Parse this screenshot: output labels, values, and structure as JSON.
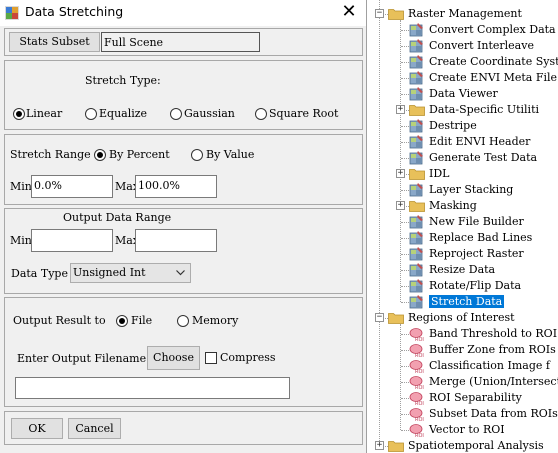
{
  "dialog": {
    "title": "Data Stretching",
    "stats_subset_button": "Stats Subset",
    "subset_value": "Full Scene",
    "stretch_type": {
      "label": "Stretch Type:",
      "options": [
        "Linear",
        "Equalize",
        "Gaussian",
        "Square Root"
      ],
      "selected": "Linear"
    },
    "stretch_range": {
      "label": "Stretch Range",
      "options": [
        "By Percent",
        "By Value"
      ],
      "selected": "By Percent",
      "min_label": "Min",
      "min_value": "0.0%",
      "max_label": "Max",
      "max_value": "100.0%"
    },
    "output_range": {
      "label": "Output Data Range",
      "min_label": "Min",
      "min_value": "",
      "max_label": "Max",
      "max_value": ""
    },
    "data_type": {
      "label": "Data Type",
      "value": "Unsigned Int"
    },
    "output": {
      "label": "Output Result to",
      "options": [
        "File",
        "Memory"
      ],
      "selected": "File",
      "filename_label": "Enter Output Filename",
      "choose_button": "Choose",
      "compress_label": "Compress",
      "compress_checked": false,
      "filename_value": ""
    },
    "ok_button": "OK",
    "cancel_button": "Cancel"
  },
  "tree": {
    "top_partial": "Raster Management",
    "items": [
      {
        "label": "Raster Management",
        "kind": "folder",
        "expanded": true
      },
      {
        "label": "Convert Complex Data S",
        "kind": "tool"
      },
      {
        "label": "Convert Interleave",
        "kind": "tool"
      },
      {
        "label": "Create Coordinate Syst",
        "kind": "tool"
      },
      {
        "label": "Create ENVI Meta File",
        "kind": "tool"
      },
      {
        "label": "Data Viewer",
        "kind": "tool"
      },
      {
        "label": "Data-Specific Utiliti",
        "kind": "folder",
        "expanded": false
      },
      {
        "label": "Destripe",
        "kind": "tool"
      },
      {
        "label": "Edit ENVI Header",
        "kind": "tool"
      },
      {
        "label": "Generate Test Data",
        "kind": "tool"
      },
      {
        "label": "IDL",
        "kind": "folder",
        "expanded": false
      },
      {
        "label": "Layer Stacking",
        "kind": "tool"
      },
      {
        "label": "Masking",
        "kind": "folder",
        "expanded": false
      },
      {
        "label": "New File Builder",
        "kind": "tool"
      },
      {
        "label": "Replace Bad Lines",
        "kind": "tool"
      },
      {
        "label": "Reproject Raster",
        "kind": "tool"
      },
      {
        "label": "Resize Data",
        "kind": "tool"
      },
      {
        "label": "Rotate/Flip Data",
        "kind": "tool"
      },
      {
        "label": "Stretch Data",
        "kind": "tool",
        "selected": true
      },
      {
        "label": "Regions of Interest",
        "kind": "folder",
        "expanded": true
      },
      {
        "label": "Band Threshold to ROI",
        "kind": "roi"
      },
      {
        "label": "Buffer Zone from ROIs",
        "kind": "roi"
      },
      {
        "label": "Classification Image f",
        "kind": "roi"
      },
      {
        "label": "Merge (Union/Intersect",
        "kind": "roi"
      },
      {
        "label": "ROI Separability",
        "kind": "roi"
      },
      {
        "label": "Subset Data from ROIs",
        "kind": "roi"
      },
      {
        "label": "Vector to ROI",
        "kind": "roi"
      },
      {
        "label": "Spatiotemporal Analysis",
        "kind": "folder",
        "expanded": false
      }
    ]
  },
  "colors": {
    "selection": "#0078d7",
    "folder": "#e8c05a",
    "dialog_bg": "#f0f0f0"
  }
}
